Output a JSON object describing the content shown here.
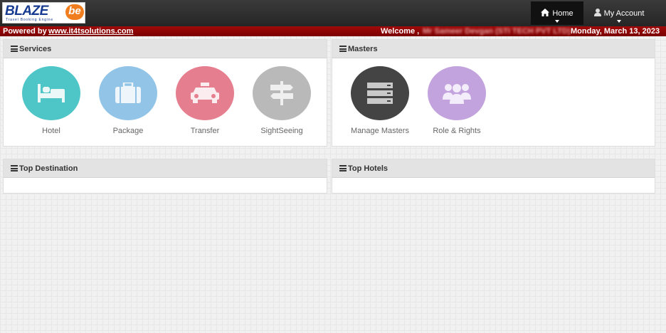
{
  "header": {
    "logo_main": "BLAZE",
    "logo_badge": "be",
    "logo_tagline": "Travel Booking Engine",
    "nav": [
      {
        "label": "Home",
        "icon": "home-icon"
      },
      {
        "label": "My Account",
        "icon": "user-icon"
      }
    ]
  },
  "infobar": {
    "powered_label": "Powered by",
    "site_link": "www.it4tsolutions.com",
    "welcome_label": "Welcome ,",
    "user_name": "Mr Sameer Devgan (STI TECH PVT LTD)",
    "date": "Monday, March 13, 2023"
  },
  "panels": {
    "services": {
      "title": "Services",
      "items": [
        {
          "label": "Hotel",
          "icon": "bed-icon",
          "color": "#4ec5c7"
        },
        {
          "label": "Package",
          "icon": "suitcase-icon",
          "color": "#92c4e7"
        },
        {
          "label": "Transfer",
          "icon": "taxi-icon",
          "color": "#e57f8f"
        },
        {
          "label": "SightSeeing",
          "icon": "signpost-icon",
          "color": "#b9b9b9"
        }
      ]
    },
    "masters": {
      "title": "Masters",
      "items": [
        {
          "label": "Manage Masters",
          "icon": "server-icon",
          "color": "#444444"
        },
        {
          "label": "Role & Rights",
          "icon": "users-group-icon",
          "color": "#c3a3dd"
        }
      ]
    },
    "top_destination": {
      "title": "Top Destination"
    },
    "top_hotels": {
      "title": "Top Hotels"
    }
  }
}
